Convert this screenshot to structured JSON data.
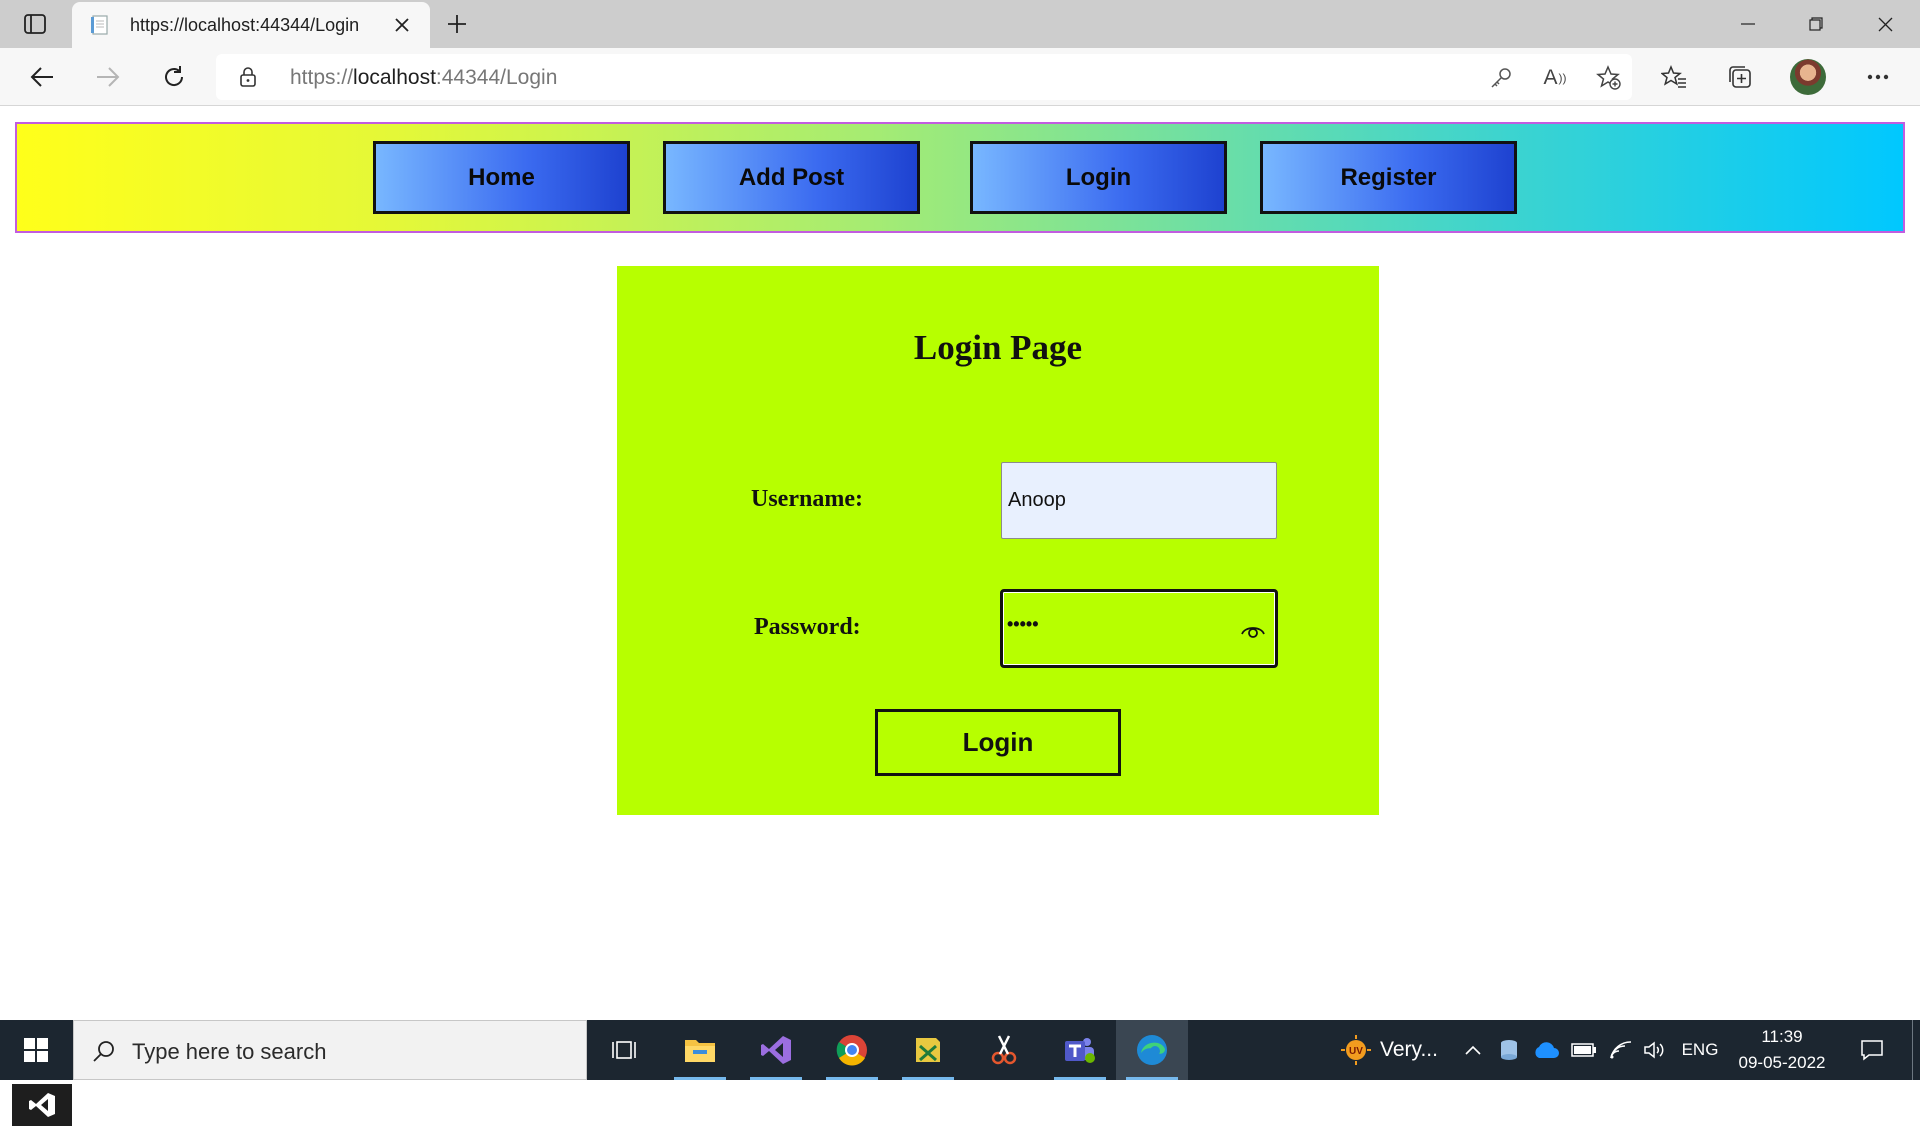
{
  "browser": {
    "tab_title": "https://localhost:44344/Login",
    "url_scheme": "https://",
    "url_host": "localhost",
    "url_rest": ":44344/Login",
    "read_aloud_label": "A"
  },
  "nav": {
    "home": "Home",
    "add_post": "Add Post",
    "login": "Login",
    "register": "Register"
  },
  "login_form": {
    "title": "Login Page",
    "username_label": "Username:",
    "username_value": "Anoop",
    "password_label": "Password:",
    "password_mask": "•••••",
    "submit_label": "Login"
  },
  "taskbar": {
    "search_placeholder": "Type here to search",
    "weather_text": "Very...",
    "weather_badge": "UV",
    "language": "ENG",
    "time": "11:39",
    "date": "09-05-2022"
  },
  "colors": {
    "panel_bg": "#b7ff00",
    "nav_gradient_start": "#ffff1a",
    "nav_gradient_end": "#00c8ff",
    "nav_border": "#c25ce0",
    "nav_button_gradient": "#78b7ff to #1e42d0",
    "username_bg": "#e8f0fe"
  }
}
